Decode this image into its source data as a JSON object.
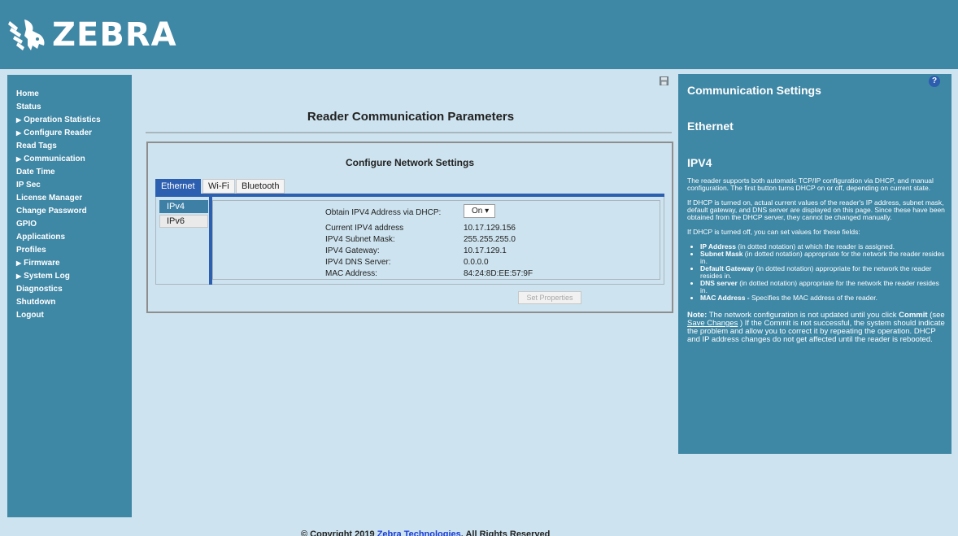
{
  "brand": {
    "name": "ZEBRA",
    "logo_icon": "zebra-head-icon"
  },
  "sidebar": {
    "items": [
      {
        "label": "Home",
        "expandable": false
      },
      {
        "label": "Status",
        "expandable": false
      },
      {
        "label": "Operation Statistics",
        "expandable": true
      },
      {
        "label": "Configure Reader",
        "expandable": true
      },
      {
        "label": "Read Tags",
        "expandable": false
      },
      {
        "label": "Communication",
        "expandable": true
      },
      {
        "label": "Date Time",
        "expandable": false
      },
      {
        "label": "IP Sec",
        "expandable": false
      },
      {
        "label": "License Manager",
        "expandable": false
      },
      {
        "label": "Change Password",
        "expandable": false
      },
      {
        "label": "GPIO",
        "expandable": false
      },
      {
        "label": "Applications",
        "expandable": false
      },
      {
        "label": "Profiles",
        "expandable": false
      },
      {
        "label": "Firmware",
        "expandable": true
      },
      {
        "label": "System Log",
        "expandable": true
      },
      {
        "label": "Diagnostics",
        "expandable": false
      },
      {
        "label": "Shutdown",
        "expandable": false
      },
      {
        "label": "Logout",
        "expandable": false
      }
    ],
    "expand_glyph": "▶"
  },
  "main": {
    "title": "Reader Communication Parameters",
    "panel_title": "Configure Network Settings",
    "tabs": [
      {
        "label": "Ethernet",
        "active": true
      },
      {
        "label": "Wi-Fi",
        "active": false
      },
      {
        "label": "Bluetooth",
        "active": false
      }
    ],
    "subtabs": [
      {
        "label": "IPv4",
        "active": true
      },
      {
        "label": "IPv6",
        "active": false
      }
    ],
    "dhcp": {
      "label": "Obtain IPV4 Address via DHCP:",
      "value": "On",
      "caret": "▾"
    },
    "fields": [
      {
        "label": "Current IPV4 address",
        "value": "10.17.129.156"
      },
      {
        "label": "IPV4 Subnet Mask:",
        "value": "255.255.255.0"
      },
      {
        "label": "IPV4 Gateway:",
        "value": "10.17.129.1"
      },
      {
        "label": "IPV4 DNS Server:",
        "value": "0.0.0.0"
      },
      {
        "label": "MAC Address:",
        "value": "84:24:8D:EE:57:9F"
      }
    ],
    "set_button": "Set Properties"
  },
  "help": {
    "icon_label": "?",
    "title": "Communication Settings",
    "section": "Ethernet",
    "subsection": "IPV4",
    "p1": "The reader supports both automatic TCP/IP configuration via DHCP, and manual configuration. The first button turns DHCP on or off, depending on current state.",
    "p2": "If DHCP is turned on, actual current values of the reader's IP address, subnet mask, default gateway, and DNS server are displayed on this page. Since these have been obtained from the DHCP server, they cannot be changed manually.",
    "p3": "If DHCP is turned off, you can set values for these fields:",
    "bullets": [
      {
        "term": "IP Address",
        "text": " (in dotted notation) at which the reader is assigned."
      },
      {
        "term": "Subnet Mask",
        "text": " (in dotted notation) appropriate for the network the reader resides in."
      },
      {
        "term": "Default Gateway",
        "text": " (in dotted notation) appropriate for the network the reader resides in."
      },
      {
        "term": "DNS server",
        "text": " (in dotted notation) appropriate for the network the reader resides in."
      },
      {
        "term": "MAC Address -",
        "text": " Specifies the MAC address of the reader."
      }
    ],
    "note_label": "Note:",
    "note_text_1": " The network configuration is not updated until you click ",
    "note_commit": "Commit",
    "note_text_2": " (see ",
    "note_link": "Save Changes",
    "note_text_3": " ) If the Commit is not successful, the system should indicate the problem and allow you to correct it by repeating the operation. DHCP and IP address changes do not get affected until the reader is rebooted."
  },
  "footer": {
    "prefix": "© Copyright 2019 ",
    "link": "Zebra Technologies",
    "suffix": ". All Rights Reserved"
  },
  "colors": {
    "header_bg": "#3e87a5",
    "page_bg": "#cde3ef",
    "tab_active": "#2d5fb1",
    "link": "#1a3bd4"
  }
}
